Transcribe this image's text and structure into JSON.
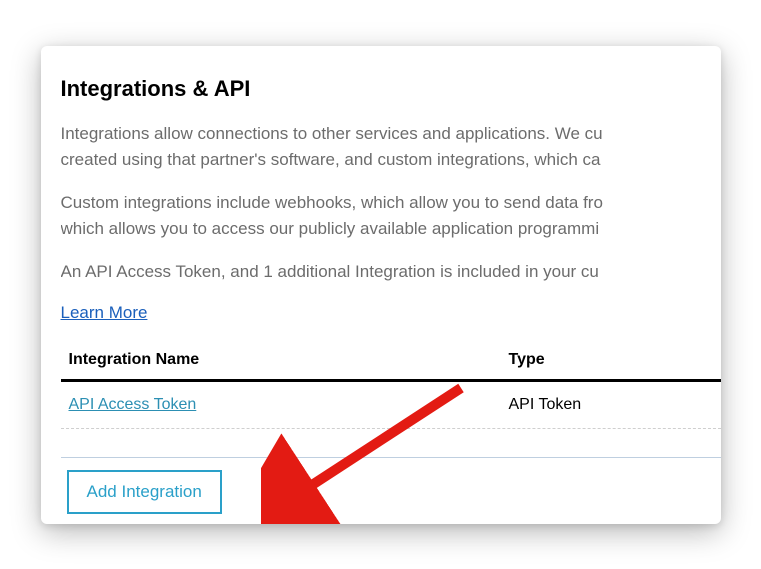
{
  "title": "Integrations & API",
  "paragraphs": {
    "p1a": "Integrations allow connections to other services and applications. We cu",
    "p1b": "created using that partner's software, and custom integrations, which ca",
    "p2a": "Custom integrations include webhooks, which allow you to send data fro",
    "p2b": "which allows you to access our publicly available application programmi",
    "p3": "An API Access Token, and 1 additional Integration is included in your cu"
  },
  "learn_more": "Learn More",
  "table": {
    "headers": {
      "name": "Integration Name",
      "type": "Type"
    },
    "rows": [
      {
        "name": "API Access Token",
        "type": "API Token"
      }
    ]
  },
  "add_button": "Add Integration"
}
